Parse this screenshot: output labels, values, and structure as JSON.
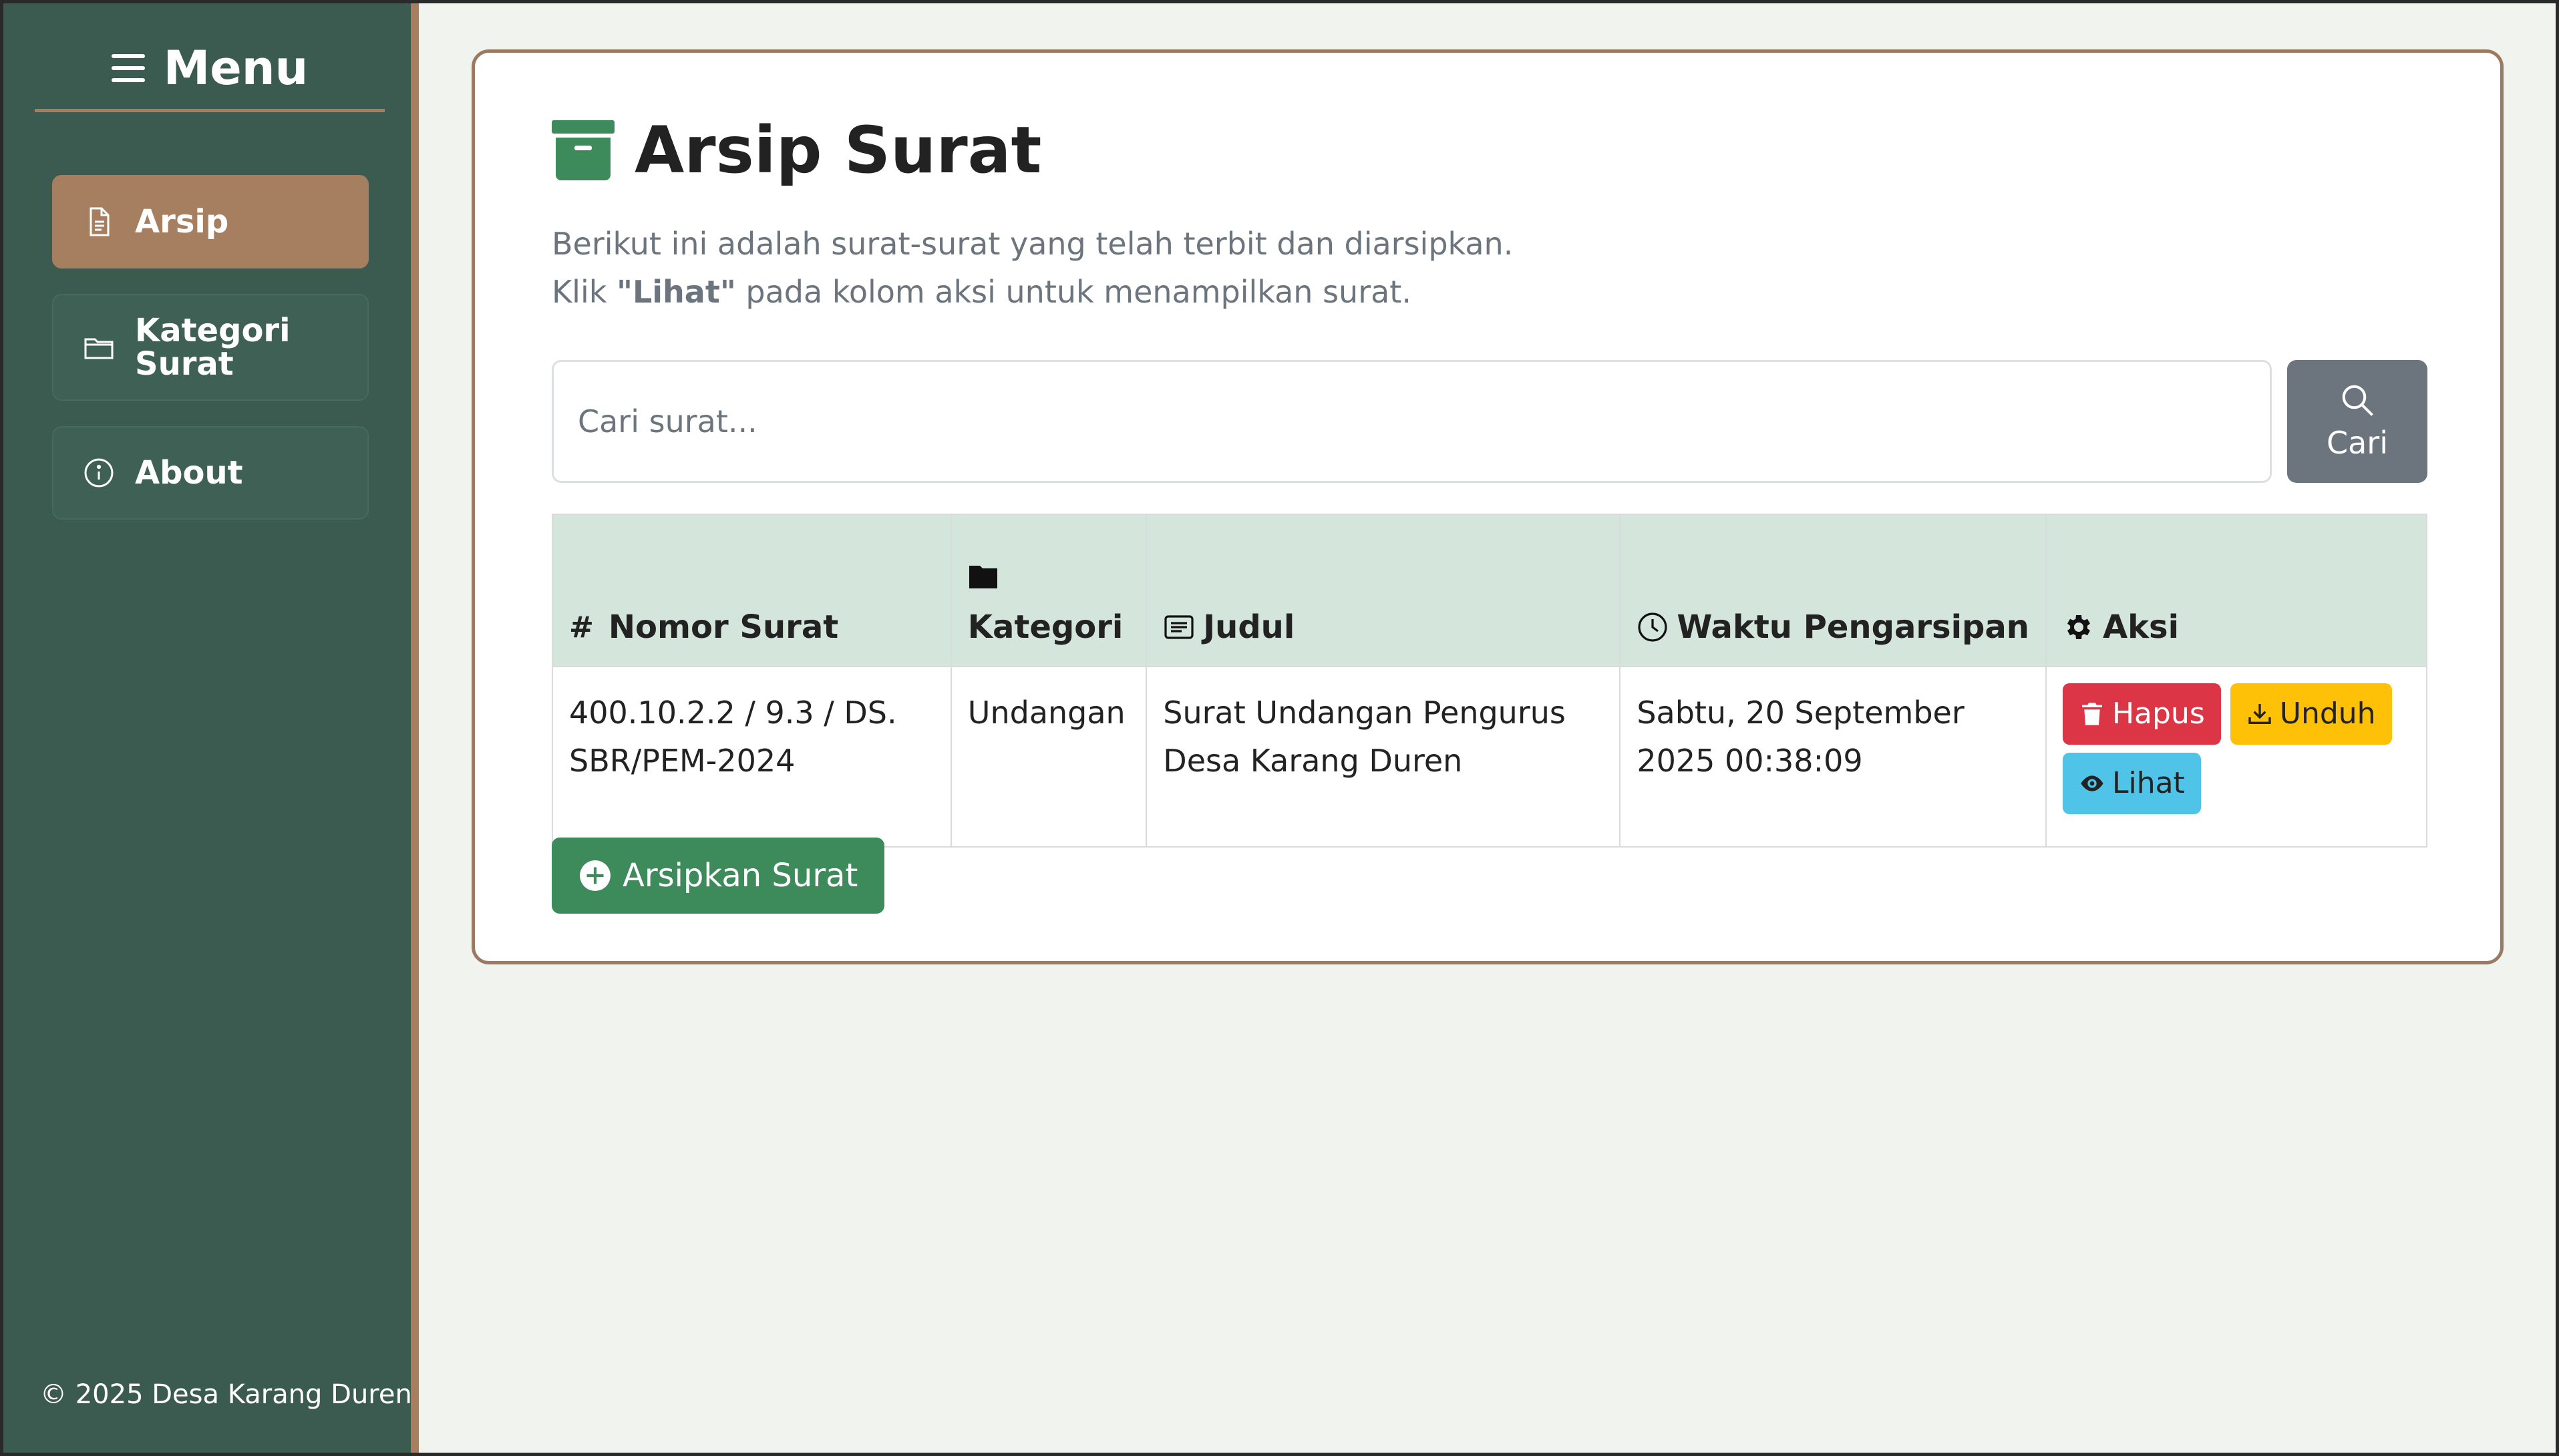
{
  "sidebar": {
    "title": "Menu",
    "items": [
      {
        "label": "Arsip",
        "icon": "document-icon",
        "active": true
      },
      {
        "label": "Kategori Surat",
        "icon": "folder-icon",
        "active": false
      },
      {
        "label": "About",
        "icon": "info-icon",
        "active": false
      }
    ],
    "footer": "© 2025 Desa Karang Duren"
  },
  "page": {
    "title": "Arsip Surat",
    "description_line1": "Berikut ini adalah surat-surat yang telah terbit dan diarsipkan.",
    "description_line2_prefix": "Klik ",
    "description_line2_bold": "\"Lihat\"",
    "description_line2_suffix": " pada kolom aksi untuk menampilkan surat."
  },
  "search": {
    "placeholder": "Cari surat...",
    "value": "",
    "button_label": "Cari"
  },
  "table": {
    "headers": {
      "nomor_symbol": "#",
      "nomor": "Nomor Surat",
      "kategori": "Kategori",
      "judul": "Judul",
      "waktu": "Waktu Pengarsipan",
      "aksi": "Aksi"
    },
    "rows": [
      {
        "nomor": "400.10.2.2 / 9.3 / DS. SBR/PEM-2024",
        "kategori": "Undangan",
        "judul": "Surat Undangan Pengurus Desa Karang Duren",
        "waktu": "Sabtu, 20 September 2025 00:38:09",
        "actions": {
          "hapus": "Hapus",
          "unduh": "Unduh",
          "lihat": "Lihat"
        }
      }
    ]
  },
  "add_button": "Arsipkan Surat",
  "colors": {
    "sidebar_bg": "#3b5b50",
    "accent_brown": "#a57f5f",
    "table_header": "#d4e6dc",
    "primary_green": "#3d8a5b",
    "danger": "#dc3545",
    "warning": "#ffc107",
    "info": "#4fc3e8",
    "secondary": "#6c757d"
  }
}
